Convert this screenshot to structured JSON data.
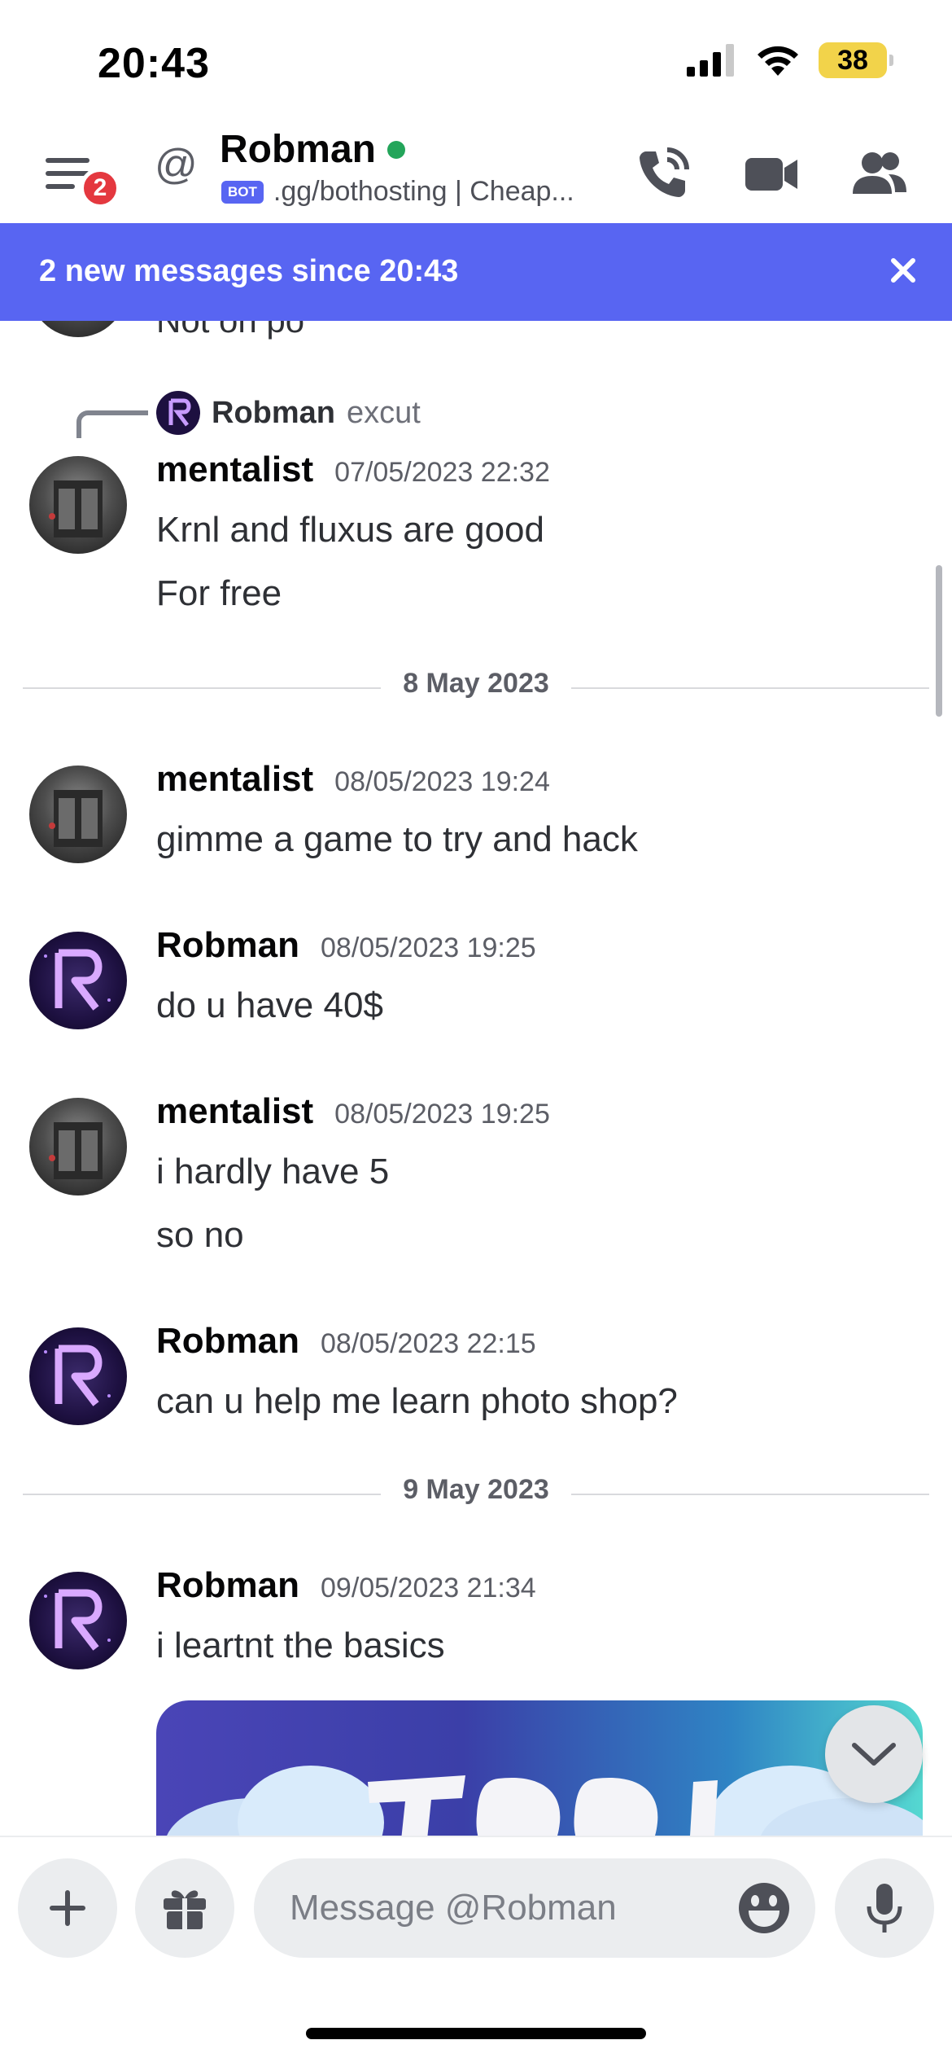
{
  "status_bar": {
    "time": "20:43",
    "battery": "38"
  },
  "header": {
    "notification_count": "2",
    "channel_name": "Robman",
    "bot_tag": "BOT",
    "subtitle": ".gg/bothosting | Cheap..."
  },
  "banner": {
    "text": "2 new messages since 20:43"
  },
  "cut_message": {
    "text": "Not on po"
  },
  "reply": {
    "author": "Robman",
    "text": "excut"
  },
  "messages": [
    {
      "author": "mentalist",
      "timestamp": "07/05/2023 22:32",
      "lines": [
        "Krnl and fluxus are good",
        "For free"
      ]
    },
    {
      "author": "mentalist",
      "timestamp": "08/05/2023 19:24",
      "lines": [
        "gimme a game to try and hack"
      ]
    },
    {
      "author": "Robman",
      "timestamp": "08/05/2023 19:25",
      "lines": [
        "do u have 40$"
      ]
    },
    {
      "author": "mentalist",
      "timestamp": "08/05/2023 19:25",
      "lines": [
        "i hardly have 5",
        "so no"
      ]
    },
    {
      "author": "Robman",
      "timestamp": "08/05/2023 22:15",
      "lines": [
        "can u help me learn photo shop?"
      ]
    },
    {
      "author": "Robman",
      "timestamp": "09/05/2023 21:34",
      "lines": [
        "i leartnt the basics"
      ]
    }
  ],
  "dividers": [
    "8 May 2023",
    "9 May 2023"
  ],
  "composer": {
    "placeholder": "Message @Robman"
  },
  "colors": {
    "accent": "#5865f2",
    "online": "#23a55a",
    "badge": "#e4383f"
  }
}
